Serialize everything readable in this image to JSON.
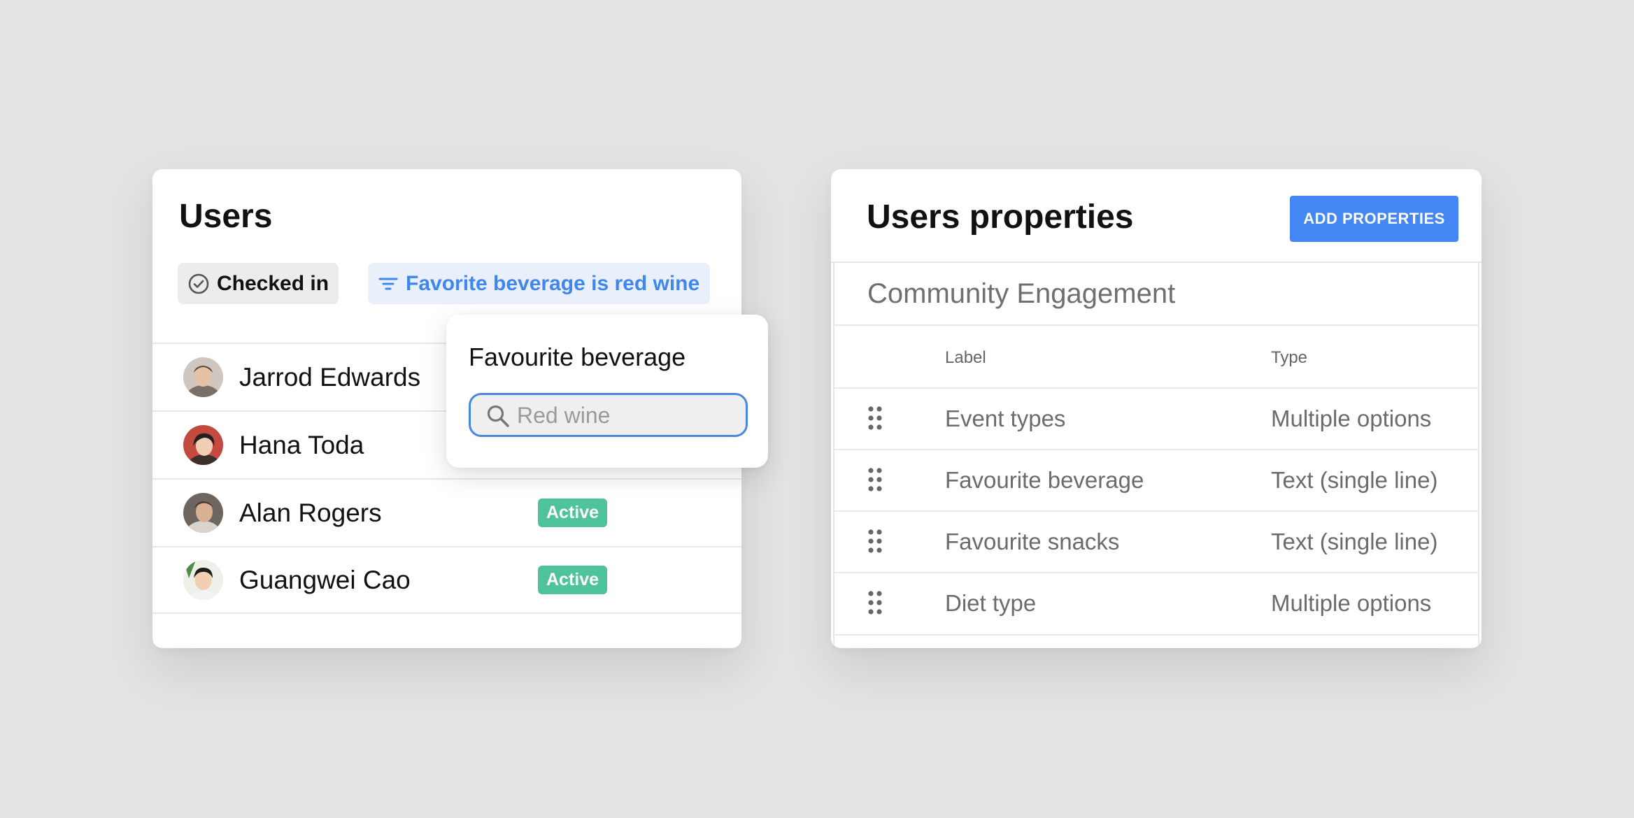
{
  "users_panel": {
    "title": "Users",
    "chips": {
      "checked_in": "Checked in",
      "filter": "Favorite beverage is red wine"
    },
    "rows": [
      {
        "name": "Jarrod Edwards",
        "status": ""
      },
      {
        "name": "Hana Toda",
        "status": ""
      },
      {
        "name": "Alan Rogers",
        "status": "Active"
      },
      {
        "name": "Guangwei Cao",
        "status": "Active"
      }
    ]
  },
  "filter_popover": {
    "title": "Favourite beverage",
    "search": {
      "value": "",
      "placeholder": "Red wine"
    }
  },
  "properties_panel": {
    "title": "Users properties",
    "add_button": "ADD PROPERTIES",
    "section_title": "Community Engagement",
    "columns": {
      "label": "Label",
      "type": "Type"
    },
    "rows": [
      {
        "label": "Event types",
        "type": "Multiple options"
      },
      {
        "label": "Favourite beverage",
        "type": "Text (single line)"
      },
      {
        "label": "Favourite snacks",
        "type": "Text (single line)"
      },
      {
        "label": "Diet type",
        "type": "Multiple options"
      }
    ]
  },
  "colors": {
    "background": "#e3e3e3",
    "accent_blue": "#4586f5",
    "filter_text": "#3f87ec",
    "active_badge": "#4fc39a"
  },
  "icons": [
    "check-circle-icon",
    "filter-icon",
    "search-icon",
    "drag-handle-icon",
    "avatar"
  ]
}
